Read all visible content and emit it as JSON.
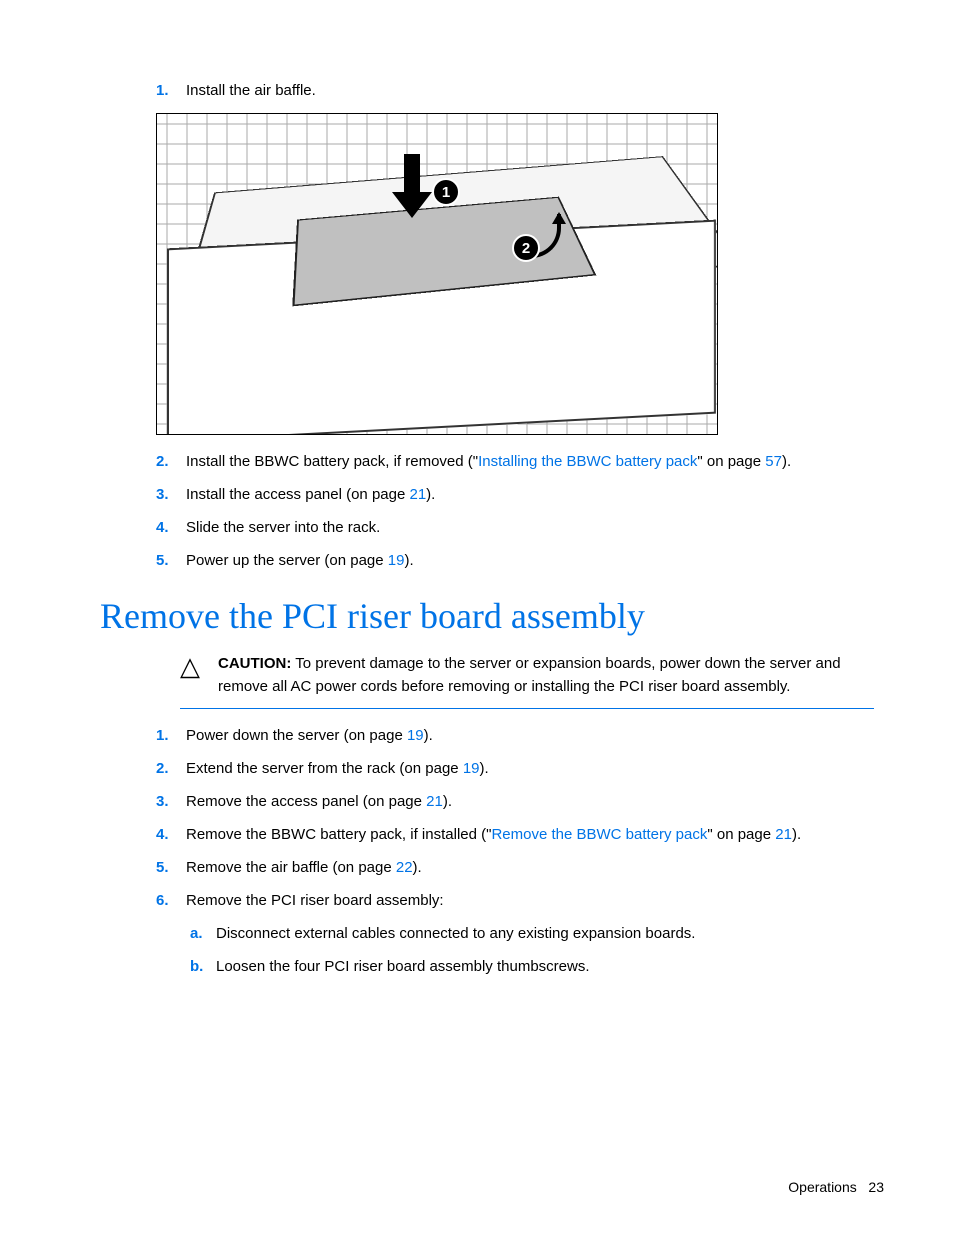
{
  "top_steps": [
    {
      "num": "1.",
      "text": "Install the air baffle."
    },
    {
      "num": "2.",
      "parts": [
        {
          "t": "Install the BBWC battery pack, if removed (\""
        },
        {
          "t": "Installing the BBWC battery pack",
          "link": true
        },
        {
          "t": "\" on page "
        },
        {
          "t": "57",
          "link": true
        },
        {
          "t": ")."
        }
      ]
    },
    {
      "num": "3.",
      "parts": [
        {
          "t": "Install the access panel (on page "
        },
        {
          "t": "21",
          "link": true
        },
        {
          "t": ")."
        }
      ]
    },
    {
      "num": "4.",
      "text": "Slide the server into the rack."
    },
    {
      "num": "5.",
      "parts": [
        {
          "t": "Power up the server (on page "
        },
        {
          "t": "19",
          "link": true
        },
        {
          "t": ")."
        }
      ]
    }
  ],
  "figure": {
    "callout1": "1",
    "callout2": "2"
  },
  "section_heading": "Remove the PCI riser board assembly",
  "caution": {
    "icon": "△",
    "label": "CAUTION:",
    "text": "To prevent damage to the server or expansion boards, power down the server and remove all AC power cords before removing or installing the PCI riser board assembly."
  },
  "bottom_steps": [
    {
      "num": "1.",
      "parts": [
        {
          "t": "Power down the server (on page "
        },
        {
          "t": "19",
          "link": true
        },
        {
          "t": ")."
        }
      ]
    },
    {
      "num": "2.",
      "parts": [
        {
          "t": "Extend the server from the rack (on page "
        },
        {
          "t": "19",
          "link": true
        },
        {
          "t": ")."
        }
      ]
    },
    {
      "num": "3.",
      "parts": [
        {
          "t": "Remove the access panel (on page "
        },
        {
          "t": "21",
          "link": true
        },
        {
          "t": ")."
        }
      ]
    },
    {
      "num": "4.",
      "parts": [
        {
          "t": "Remove the BBWC battery pack, if installed (\""
        },
        {
          "t": "Remove the BBWC battery pack",
          "link": true
        },
        {
          "t": "\" on page "
        },
        {
          "t": "21",
          "link": true
        },
        {
          "t": ")."
        }
      ]
    },
    {
      "num": "5.",
      "parts": [
        {
          "t": "Remove the air baffle (on page "
        },
        {
          "t": "22",
          "link": true
        },
        {
          "t": ")."
        }
      ]
    },
    {
      "num": "6.",
      "text": "Remove the PCI riser board assembly:"
    }
  ],
  "sub_steps": [
    {
      "letter": "a.",
      "text": "Disconnect external cables connected to any existing expansion boards."
    },
    {
      "letter": "b.",
      "text": "Loosen the four PCI riser board assembly thumbscrews."
    }
  ],
  "footer": {
    "section": "Operations",
    "page": "23"
  }
}
